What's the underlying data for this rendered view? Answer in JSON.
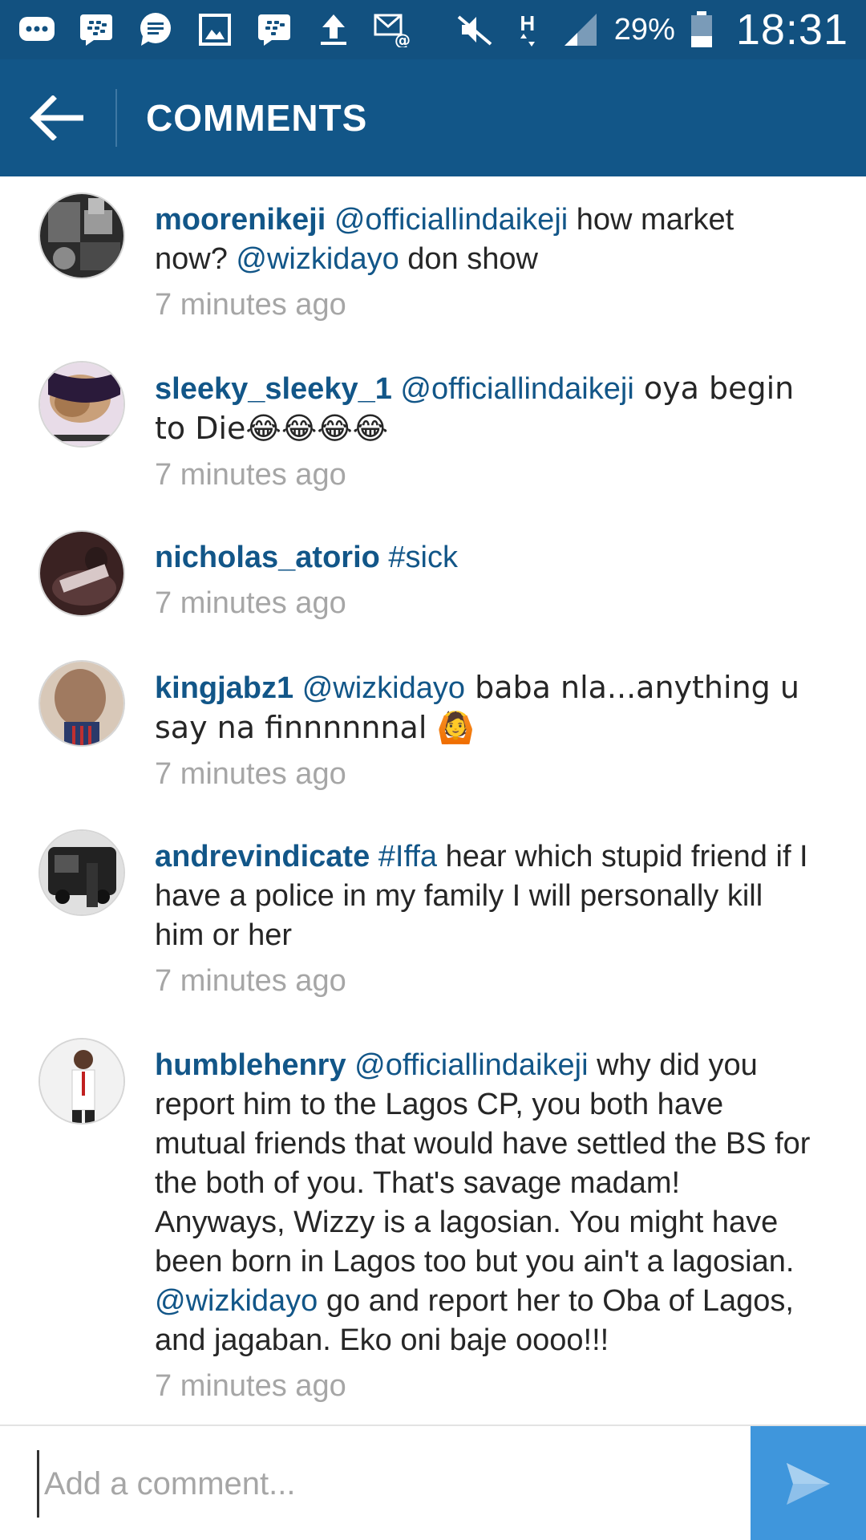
{
  "status_bar": {
    "battery_percent": "29%",
    "clock": "18:31",
    "network_type": "H",
    "icons": [
      "messages-icon",
      "bbm-icon",
      "chat-icon",
      "gallery-icon",
      "bbm-icon",
      "upload-icon",
      "email-icon",
      "mute-icon",
      "network-h-icon",
      "signal-icon",
      "battery-icon"
    ]
  },
  "header": {
    "title": "COMMENTS"
  },
  "comments": [
    {
      "username": "moorenikeji",
      "parts": [
        {
          "type": "mention",
          "text": "@officiallindaikeji"
        },
        {
          "type": "text",
          "text": " how market now? "
        },
        {
          "type": "mention",
          "text": "@wizkidayo"
        },
        {
          "type": "text",
          "text": " don show"
        }
      ],
      "time": "7 minutes ago",
      "avatar_color": "#3a3a3a"
    },
    {
      "username": "sleeky_sleeky_1",
      "parts": [
        {
          "type": "mention",
          "text": "@officiallindaikeji"
        },
        {
          "type": "text",
          "text": " oya begin to Die😂😂😂😂"
        }
      ],
      "time": "7 minutes ago",
      "avatar_color": "#7a4a8c"
    },
    {
      "username": "nicholas_atorio",
      "parts": [
        {
          "type": "mention",
          "text": "#sick"
        }
      ],
      "time": "7 minutes ago",
      "avatar_color": "#4a2a2a"
    },
    {
      "username": "kingjabz1",
      "parts": [
        {
          "type": "mention",
          "text": "@wizkidayo"
        },
        {
          "type": "text",
          "text": " baba nla...anything u say na finnnnnnal 🙆"
        }
      ],
      "time": "7 minutes ago",
      "avatar_color": "#b08f7a"
    },
    {
      "username": "andrevindicate",
      "parts": [
        {
          "type": "mention",
          "text": "#Iffa"
        },
        {
          "type": "text",
          "text": " hear which stupid friend if I have a police in my family I will personally kill him or her"
        }
      ],
      "time": "7 minutes ago",
      "avatar_color": "#555555"
    },
    {
      "username": "humblehenry",
      "parts": [
        {
          "type": "mention",
          "text": "@officiallindaikeji"
        },
        {
          "type": "text",
          "text": " why did you report him to the Lagos CP, you both have mutual friends that would have settled the BS for the both of you. That's savage madam! Anyways, Wizzy is a lagosian. You might have been born in Lagos too but you ain't a lagosian. "
        },
        {
          "type": "mention",
          "text": "@wizkidayo"
        },
        {
          "type": "text",
          "text": " go and report her to Oba of Lagos, and jagaban. Eko oni baje oooo!!!"
        }
      ],
      "time": "7 minutes ago",
      "avatar_color": "#e8e8e8"
    }
  ],
  "composer": {
    "placeholder": "Add a comment..."
  },
  "colors": {
    "status_bar": "#125180",
    "action_bar": "#125688",
    "link": "#125688",
    "timestamp": "#a6a6a6",
    "send_button": "#3f96dc"
  }
}
